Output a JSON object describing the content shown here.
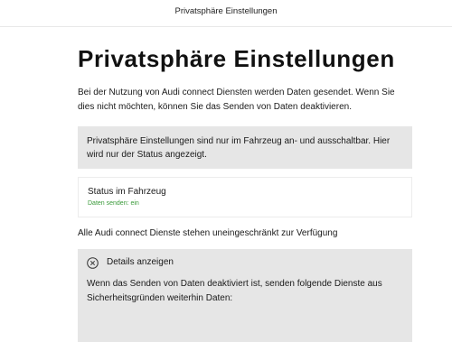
{
  "header": {
    "title": "Privatsphäre Einstellungen"
  },
  "page": {
    "title": "Privatsphäre Einstellungen",
    "intro": "Bei der Nutzung von Audi connect Diensten werden Daten gesendet. Wenn Sie dies nicht möchten, können Sie das Senden von Daten deaktivieren."
  },
  "info_notice": {
    "text": "Privatsphäre Einstellungen sind nur im Fahrzeug an- und ausschaltbar. Hier wird nur der Status angezeigt.",
    "background_color": "#e6e6e6"
  },
  "status_card": {
    "label": "Status im Fahrzeug",
    "value": "Daten senden: ein",
    "value_color": "#3a9a3a"
  },
  "services_status": {
    "text": "Alle Audi connect Dienste stehen uneingeschränkt zur Verfügung"
  },
  "details": {
    "icon": "close-circle-icon",
    "toggle_label": "Details anzeigen",
    "text": "Wenn das Senden von Daten deaktiviert ist, senden folgende Dienste aus Sicherheitsgründen weiterhin Daten:"
  }
}
